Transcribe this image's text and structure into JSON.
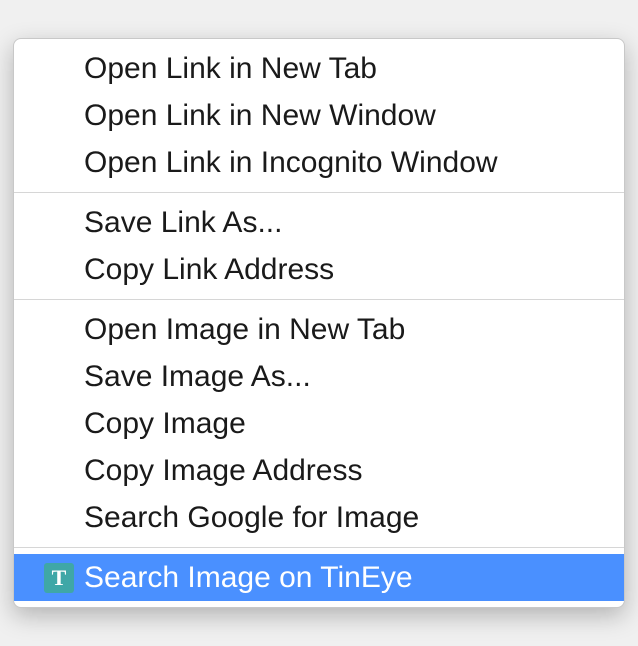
{
  "menu": {
    "groups": [
      {
        "items": [
          {
            "label": "Open Link in New Tab"
          },
          {
            "label": "Open Link in New Window"
          },
          {
            "label": "Open Link in Incognito Window"
          }
        ]
      },
      {
        "items": [
          {
            "label": "Save Link As..."
          },
          {
            "label": "Copy Link Address"
          }
        ]
      },
      {
        "items": [
          {
            "label": "Open Image in New Tab"
          },
          {
            "label": "Save Image As..."
          },
          {
            "label": "Copy Image"
          },
          {
            "label": "Copy Image Address"
          },
          {
            "label": "Search Google for Image"
          }
        ]
      },
      {
        "items": [
          {
            "label": "Search Image on TinEye",
            "icon": "T",
            "highlighted": true
          }
        ]
      }
    ]
  }
}
